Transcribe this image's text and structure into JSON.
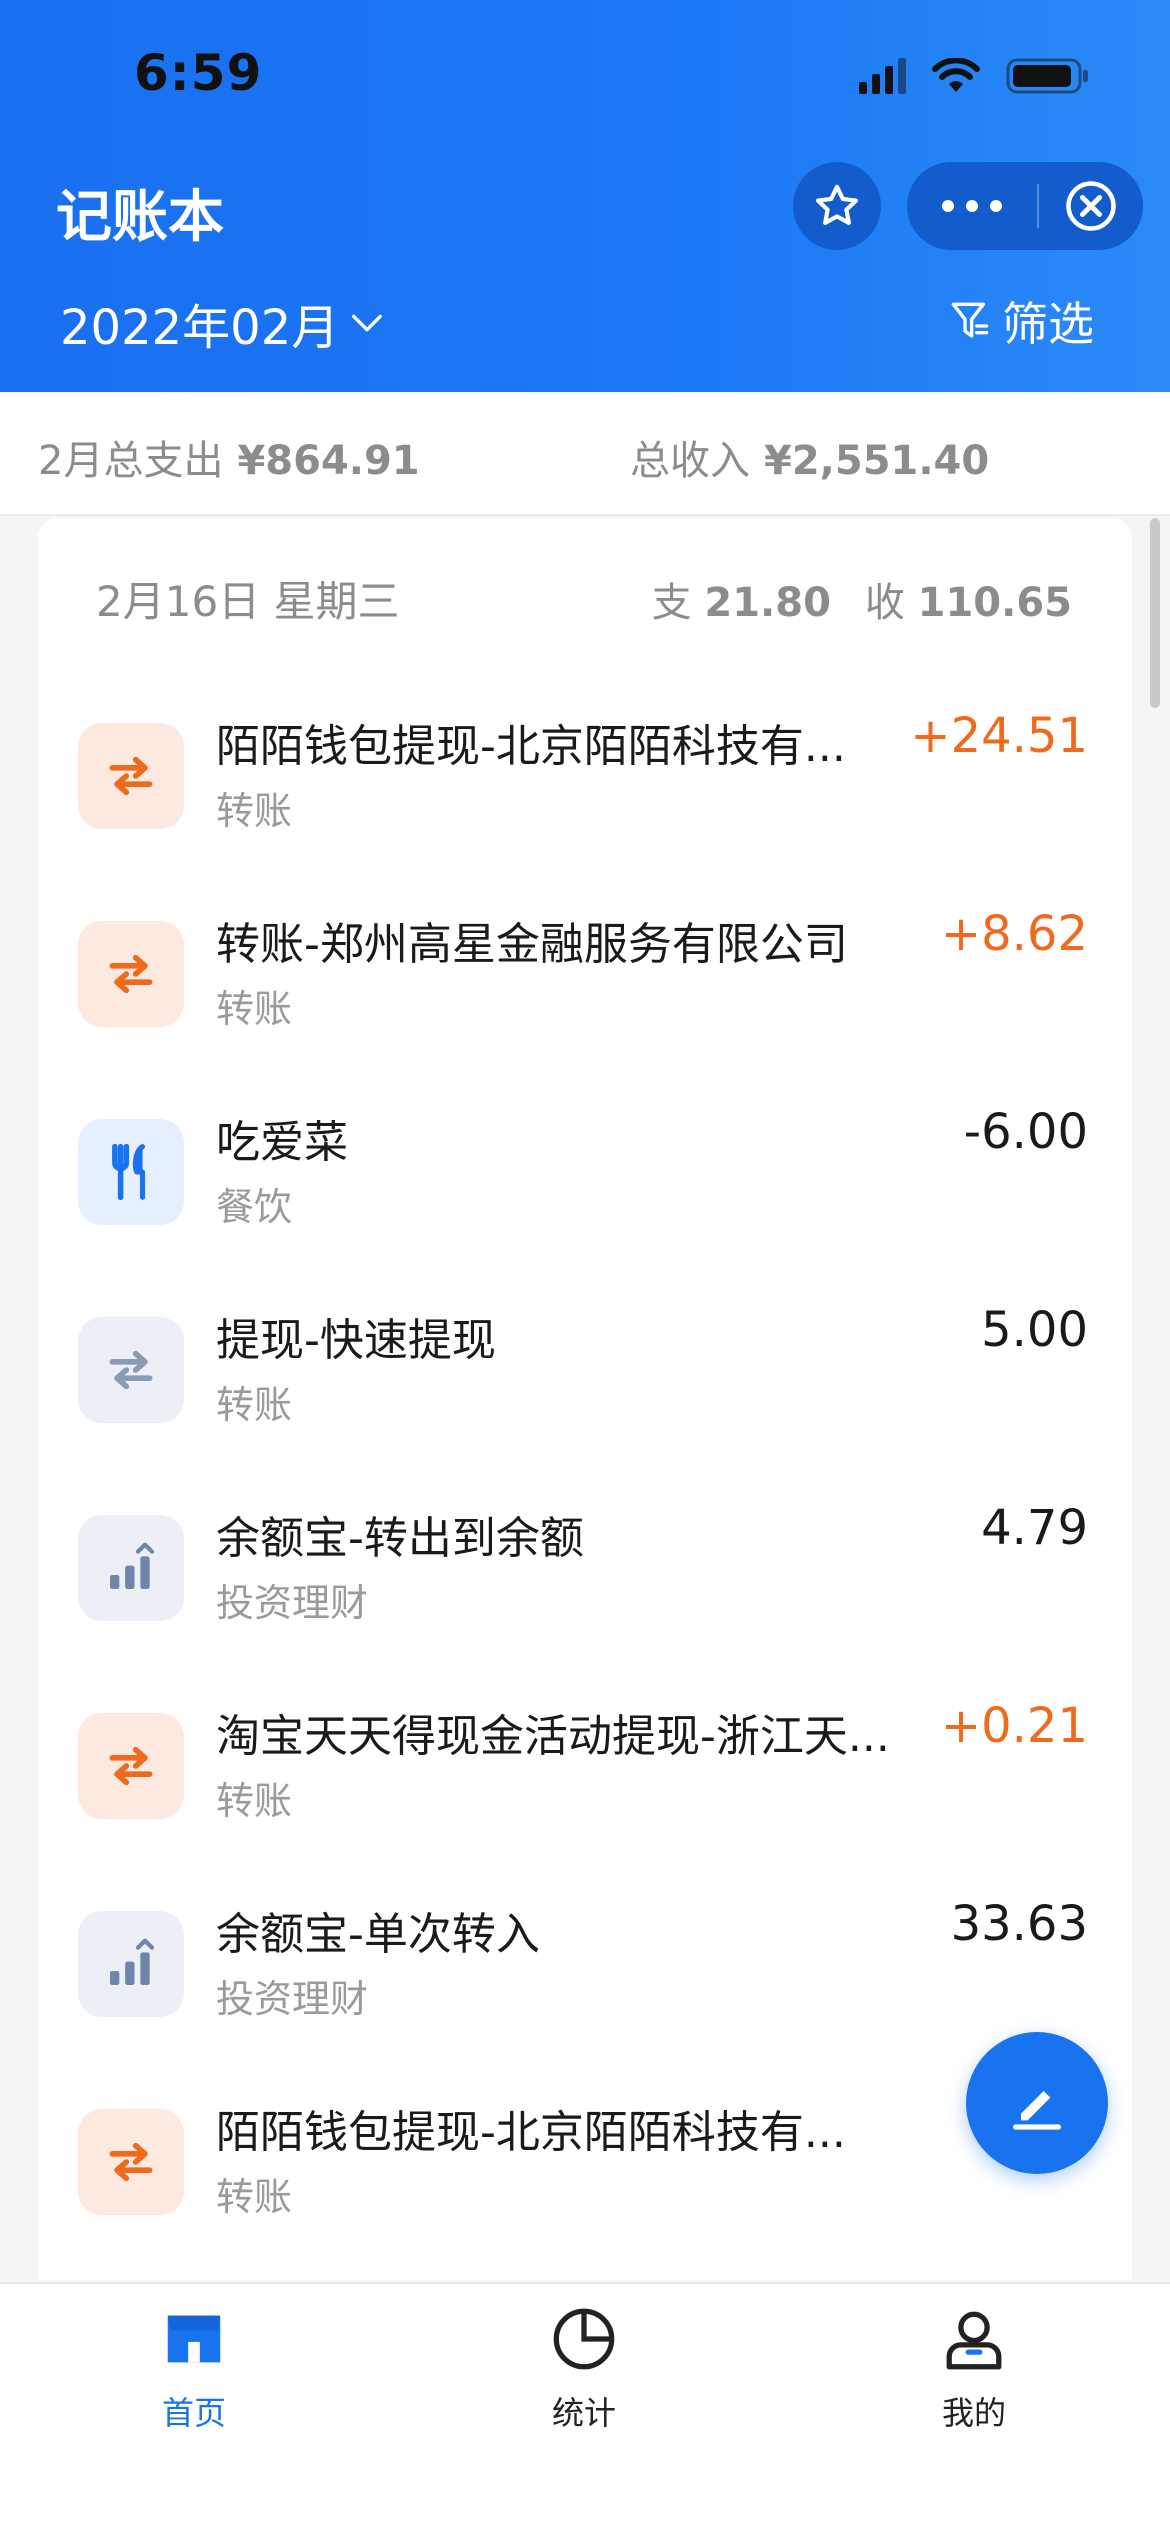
{
  "status": {
    "time": "6:59"
  },
  "header": {
    "title": "记账本",
    "month": "2022年02月",
    "filter_label": "筛选"
  },
  "summary": {
    "expense_label": "2月总支出",
    "expense_value": "¥864.91",
    "income_label": "总收入",
    "income_value": "¥2,551.40"
  },
  "day": {
    "date": "2月16日 星期三",
    "expense_label": "支",
    "expense_value": "21.80",
    "income_label": "收",
    "income_value": "110.65"
  },
  "transactions": [
    {
      "title": "陌陌钱包提现-北京陌陌科技有...",
      "category": "转账",
      "amount": "+24.51",
      "icon": "transfer-icon"
    },
    {
      "title": "转账-郑州高星金融服务有限公司",
      "category": "转账",
      "amount": "+8.62",
      "icon": "transfer-icon"
    },
    {
      "title": "吃爱菜",
      "category": "餐饮",
      "amount": "-6.00",
      "icon": "fork-knife-icon"
    },
    {
      "title": "提现-快速提现",
      "category": "转账",
      "amount": "5.00",
      "icon": "transfer-icon"
    },
    {
      "title": "余额宝-转出到余额",
      "category": "投资理财",
      "amount": "4.79",
      "icon": "bar-chart-icon"
    },
    {
      "title": "淘宝天天得现金活动提现-浙江天...",
      "category": "转账",
      "amount": "+0.21",
      "icon": "transfer-icon"
    },
    {
      "title": "余额宝-单次转入",
      "category": "投资理财",
      "amount": "33.63",
      "icon": "bar-chart-icon"
    },
    {
      "title": "陌陌钱包提现-北京陌陌科技有...",
      "category": "转账",
      "amount": "+",
      "icon": "transfer-icon"
    }
  ],
  "tabs": [
    {
      "label": "首页",
      "icon": "home-icon"
    },
    {
      "label": "统计",
      "icon": "pie-clock-icon"
    },
    {
      "label": "我的",
      "icon": "user-icon"
    }
  ],
  "colors": {
    "brand_blue": "#1a73ee",
    "income_orange": "#f06a1e"
  }
}
